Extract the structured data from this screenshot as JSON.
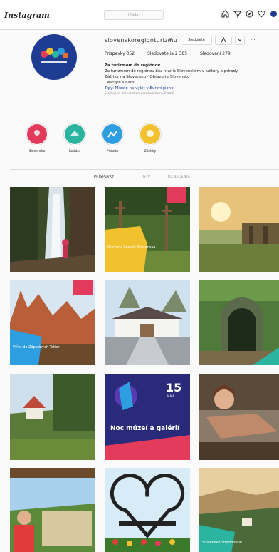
{
  "nav": {
    "logo": "Instagram",
    "search_placeholder": "Hľadať"
  },
  "profile": {
    "username": "slovenskoregionturizmu",
    "follow_label": "Sledujete",
    "more_label": "···",
    "stats": {
      "posts": "Príspevky 352",
      "followers": "Sledovatelia 2 385",
      "following": "Sledovaní 279"
    },
    "bio": {
      "name": "Za turizmom do regiónov",
      "line1": "Za turizmom do regiónov bez hraníc Slovenskom v kultúry a prírody",
      "line2": "Zážitky na Slovensku · Objavujte Slovensko",
      "line3": "Cestujte s nami",
      "link": "Tipy: Miesto na vylet v Eurorégione",
      "note": "Sledujete: slovenskoregionturizmu a 2 ďalší"
    }
  },
  "highlights": [
    {
      "label": "Slovensko",
      "color": "#e23b5b"
    },
    {
      "label": "Kultúra",
      "color": "#2bb5a0"
    },
    {
      "label": "Príroda",
      "color": "#2d9ee0"
    },
    {
      "label": "Zážitky",
      "color": "#f2c12e"
    }
  ],
  "tabs": {
    "posts": "PRÍSPEVKY",
    "igtv": "IGTV",
    "tagged": "OZNAČENIA"
  },
  "posts": [
    {
      "caption": ""
    },
    {
      "caption": "Drevené kostoly Slovenska"
    },
    {
      "caption": ""
    },
    {
      "caption": "Výlet do Západných Tatier"
    },
    {
      "caption": ""
    },
    {
      "caption": ""
    },
    {
      "caption": ""
    },
    {
      "caption": "Noc múzeí a galérií",
      "day": "15",
      "month": "MÁJA"
    },
    {
      "caption": ""
    },
    {
      "caption": ""
    },
    {
      "caption": ""
    },
    {
      "caption": "Slovenské Stredohorie"
    }
  ]
}
